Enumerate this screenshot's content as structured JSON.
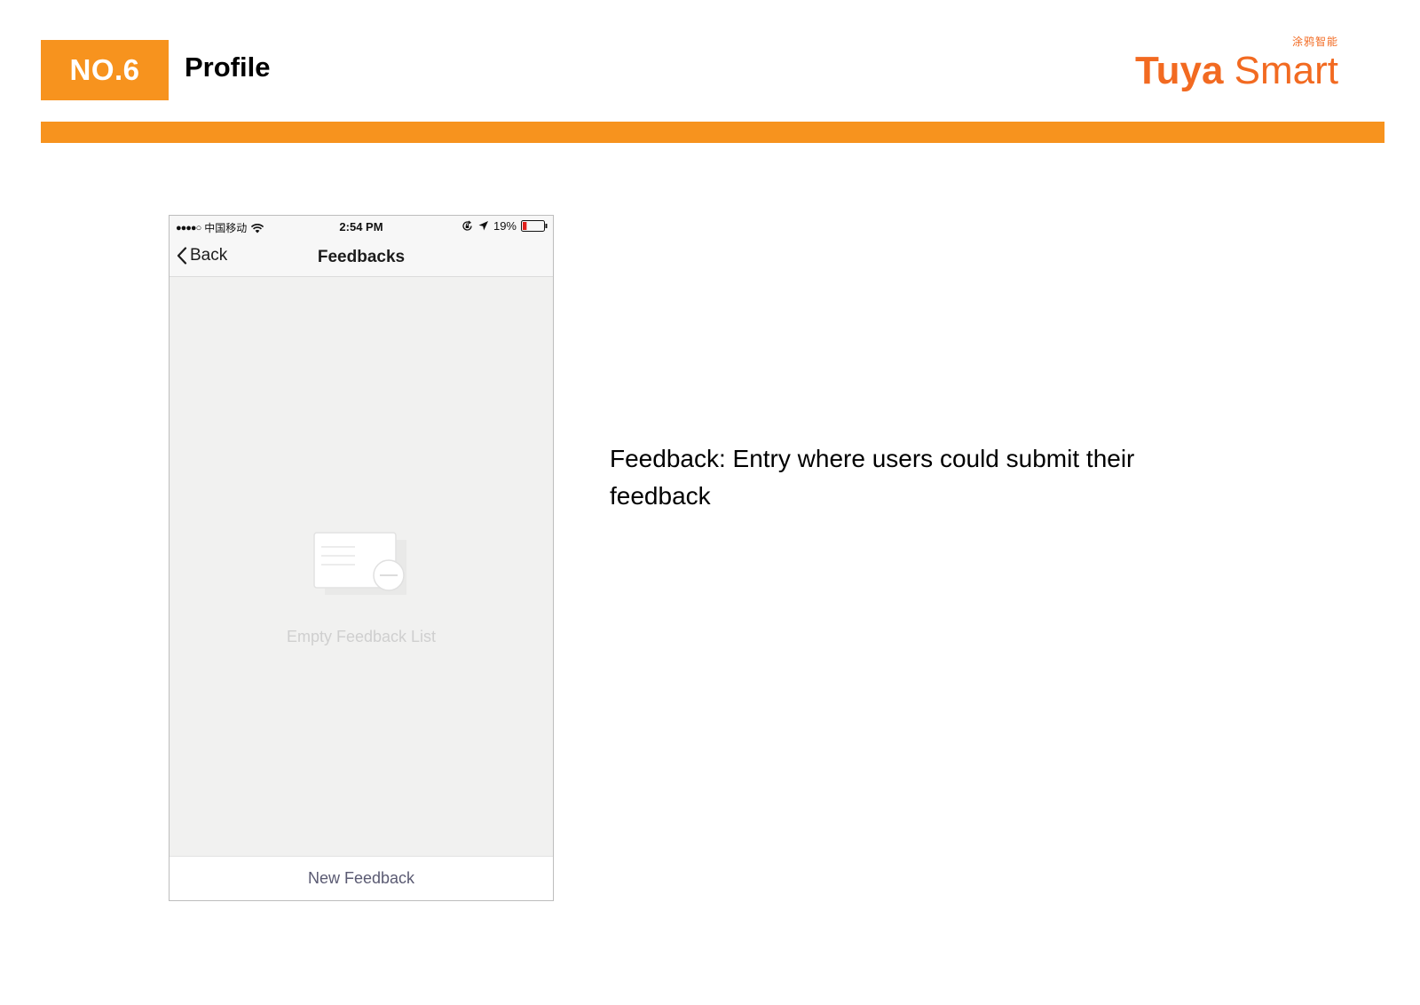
{
  "slide": {
    "badge": "NO.6",
    "title": "Profile",
    "brand_cn": "涂鸦智能",
    "brand_name_bold": "Tuya",
    "brand_name_regular": " Smart",
    "accent_color": "#f7931e",
    "brand_color": "#f26a21"
  },
  "phone": {
    "status_bar": {
      "signal": "●●●●○",
      "carrier": "中国移动",
      "time": "2:54 PM",
      "battery_percent": "19%",
      "battery_level": 0.19,
      "icons": [
        "wifi-icon",
        "orientation-lock-icon",
        "location-arrow-icon",
        "battery-icon"
      ]
    },
    "nav": {
      "back_label": "Back",
      "title": "Feedbacks",
      "back_icon": "chevron-left-icon"
    },
    "empty_state": {
      "icon": "empty-message-icon",
      "text": "Empty Feedback List"
    },
    "bottom_action": {
      "label": "New Feedback"
    }
  },
  "description": {
    "text": "Feedback: Entry where users could submit their feedback"
  }
}
